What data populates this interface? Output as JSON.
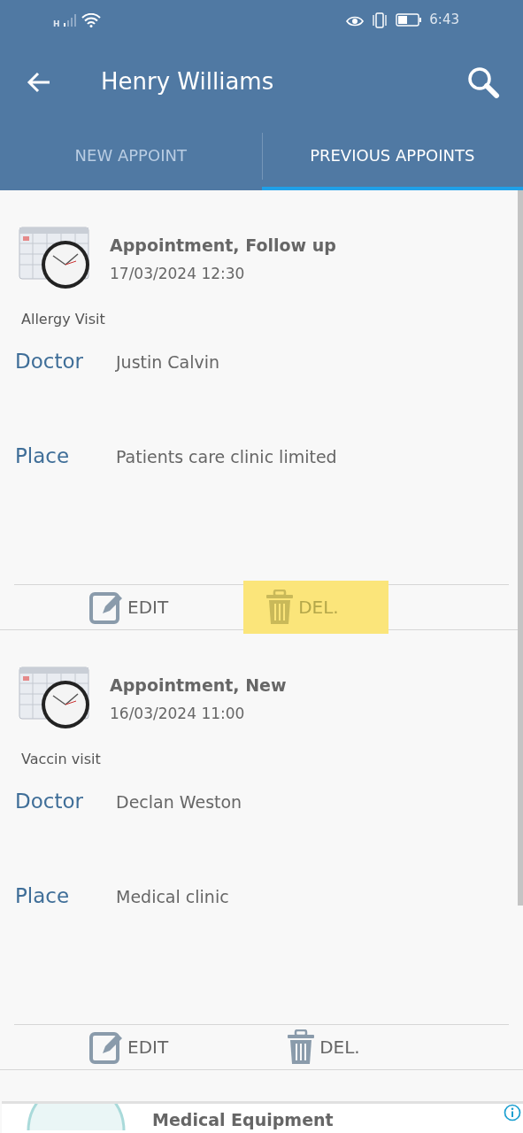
{
  "status_bar": {
    "time": "6:43",
    "network": "H"
  },
  "app_bar": {
    "title": "Henry Williams"
  },
  "tabs": [
    {
      "label": "NEW APPOINT",
      "selected": false
    },
    {
      "label": "PREVIOUS APPOINTS",
      "selected": true
    }
  ],
  "appointments": [
    {
      "title": "Appointment, Follow up",
      "datetime": "17/03/2024 12:30",
      "reason": "Allergy Visit",
      "fields": [
        {
          "label": "Doctor",
          "value": "Justin Calvin"
        },
        {
          "label": "Place",
          "value": "Patients care clinic limited"
        }
      ],
      "actions": [
        {
          "kind": "edit",
          "label": "EDIT",
          "highlighted": false
        },
        {
          "kind": "delete",
          "label": "DEL.",
          "highlighted": true
        }
      ]
    },
    {
      "title": "Appointment, New",
      "datetime": "16/03/2024 11:00",
      "reason": "Vaccin visit",
      "fields": [
        {
          "label": "Doctor",
          "value": "Declan Weston"
        },
        {
          "label": "Place",
          "value": "Medical clinic"
        }
      ],
      "actions": [
        {
          "kind": "edit",
          "label": "EDIT",
          "highlighted": false
        },
        {
          "kind": "delete",
          "label": "DEL.",
          "highlighted": false
        }
      ]
    }
  ],
  "ad": {
    "title": "Medical Equipment"
  }
}
